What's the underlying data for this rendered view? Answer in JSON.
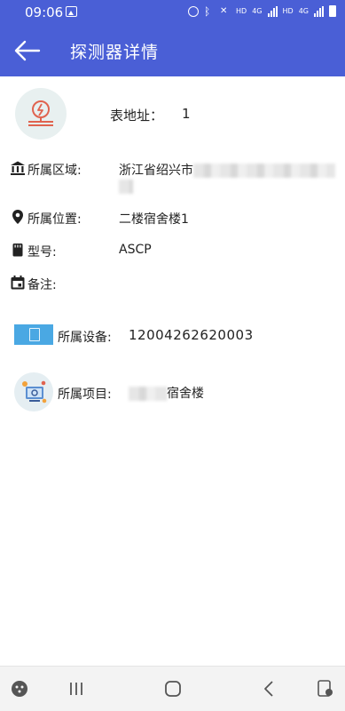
{
  "status_bar": {
    "time": "09:06",
    "hd1": "HD",
    "net1": "4G",
    "hd2": "HD",
    "net2": "4G"
  },
  "app_bar": {
    "title": "探测器详情"
  },
  "header": {
    "address_label": "表地址：",
    "address_value": "1"
  },
  "details": {
    "region_label": "所属区域:",
    "region_value": "浙江省绍兴市",
    "location_label": "所属位置:",
    "location_value": "二楼宿舍楼1",
    "model_label": "型号:",
    "model_value": "ASCP",
    "remark_label": "备注:"
  },
  "device": {
    "label": "所属设备:",
    "value": "12004262620003"
  },
  "project": {
    "label": "所属项目:",
    "value_suffix": "宿舍楼"
  },
  "colors": {
    "primary": "#4a5fd6",
    "device_icon": "#4aa8e3",
    "sensor_icon": "#e0634f"
  }
}
